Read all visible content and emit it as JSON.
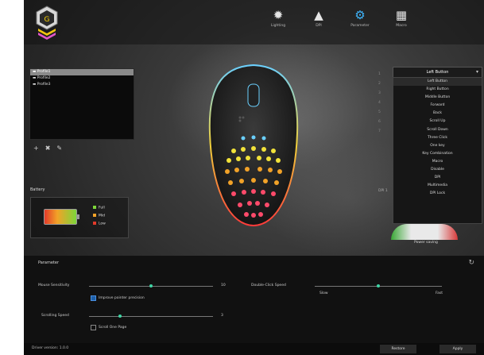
{
  "nav": [
    {
      "icon": "lighting-icon",
      "glyph": "✹",
      "label": "Lighting",
      "active": false
    },
    {
      "icon": "dpi-icon",
      "glyph": "▲",
      "label": "DPI",
      "active": false
    },
    {
      "icon": "parameter-icon",
      "glyph": "⚙",
      "label": "Parameter",
      "active": true
    },
    {
      "icon": "macro-icon",
      "glyph": "▦",
      "label": "Macro",
      "active": false
    }
  ],
  "profiles": [
    "Profile1",
    "Profile2",
    "Profile3"
  ],
  "profile_tools": {
    "add": "+",
    "delete": "✖",
    "edit": "✎"
  },
  "battery": {
    "title": "Battery",
    "legend": [
      {
        "label": "Full",
        "color": "#7dd63a"
      },
      {
        "label": "Mid",
        "color": "#f2a228"
      },
      {
        "label": "Low",
        "color": "#e23a2a"
      }
    ]
  },
  "button_numbers": [
    "1",
    "2",
    "3",
    "4",
    "5",
    "6",
    "7"
  ],
  "assign": {
    "selected": "Left Button",
    "options": [
      "Left Button",
      "Right Button",
      "Middle Button",
      "Forward",
      "Back",
      "Scroll Up",
      "Scroll Down",
      "Three Click",
      "One key",
      "Key Combination",
      "Macro",
      "Disable",
      "DPI",
      "Multimedia",
      "DPI Lock"
    ]
  },
  "dpi_label": "DPI 1",
  "polling_label": "Power saving",
  "parameter": {
    "title": "Parameter",
    "mouse_sensitivity_label": "Mouse Sensitivity",
    "mouse_sensitivity_value": "10",
    "mouse_sensitivity_level": 0.5,
    "accel_label": "Improve pointer precision",
    "accel_checked": true,
    "double_click_label": "Double-Click Speed",
    "double_click_slow": "Slow",
    "double_click_fast": "Fast",
    "double_click_level": 0.5,
    "scroll_label": "Scrolling Speed",
    "scroll_value": "3",
    "scroll_level": 0.25,
    "scroll_page_label": "Scroll One Page",
    "scroll_page_checked": false
  },
  "footer": {
    "version": "Driver version: 1.0.0",
    "restore": "Restore",
    "apply": "Apply"
  },
  "colors": {
    "accent": "#3fb7ff",
    "knob": "#40d6a6"
  }
}
